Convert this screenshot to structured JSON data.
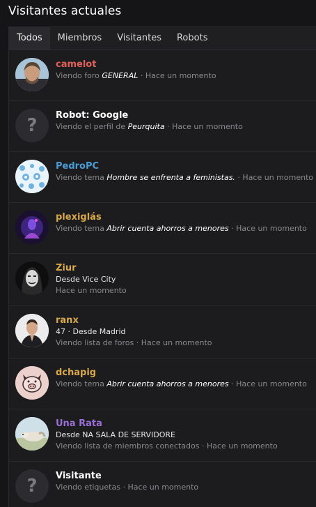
{
  "title": "Visitantes actuales",
  "tabs": [
    {
      "label": "Todos",
      "active": true
    },
    {
      "label": "Miembros",
      "active": false
    },
    {
      "label": "Visitantes",
      "active": false
    },
    {
      "label": "Robots",
      "active": false
    }
  ],
  "colors": {
    "red_user": "#e0605a",
    "blue_user": "#4b9bd6",
    "gold_user": "#d8a84a",
    "purple_user": "#9a6fd8",
    "white_user": "#ffffff"
  },
  "visitors": [
    {
      "name": "camelot",
      "activity": "Viendo foro",
      "target": "GENERAL",
      "time": "Hace un momento",
      "avatar": "photo-man-icon"
    },
    {
      "name": "Robot: Google",
      "activity": "Viendo el perfil de",
      "target": "Peurquita",
      "time": "Hace un momento",
      "avatar": "question-placeholder-icon"
    },
    {
      "name": "PedroPC",
      "activity": "Viendo tema",
      "target": "Hombre se enfrenta a feministas.",
      "time": "Hace un momento",
      "avatar": "snowflake-pattern-icon"
    },
    {
      "name": "plexiglás",
      "activity": "Viendo tema",
      "target": "Abrir cuenta ahorros a menores",
      "time": "Hace un momento",
      "avatar": "purple-figure-icon"
    },
    {
      "name": "Ziur",
      "location": "Desde Vice City",
      "time": "Hace un momento",
      "avatar": "anonymous-mask-icon"
    },
    {
      "name": "ranx",
      "location": "47 · Desde Madrid",
      "activity": "Viendo lista de foros",
      "time": "Hace un momento",
      "avatar": "man-praying-icon"
    },
    {
      "name": "dchapig",
      "activity": "Viendo tema",
      "target": "Abrir cuenta ahorros a menores",
      "time": "Hace un momento",
      "avatar": "pig-face-icon"
    },
    {
      "name": "Una Rata",
      "location": "Desde NA SALA DE SERVIDORE",
      "activity": "Viendo lista de miembros conectados",
      "time": "Hace un momento",
      "avatar": "dog-photo-icon"
    },
    {
      "name": "Visitante",
      "activity": "Viendo etiquetas",
      "time": "Hace un momento",
      "avatar": "question-placeholder-icon"
    }
  ],
  "separator": "·"
}
